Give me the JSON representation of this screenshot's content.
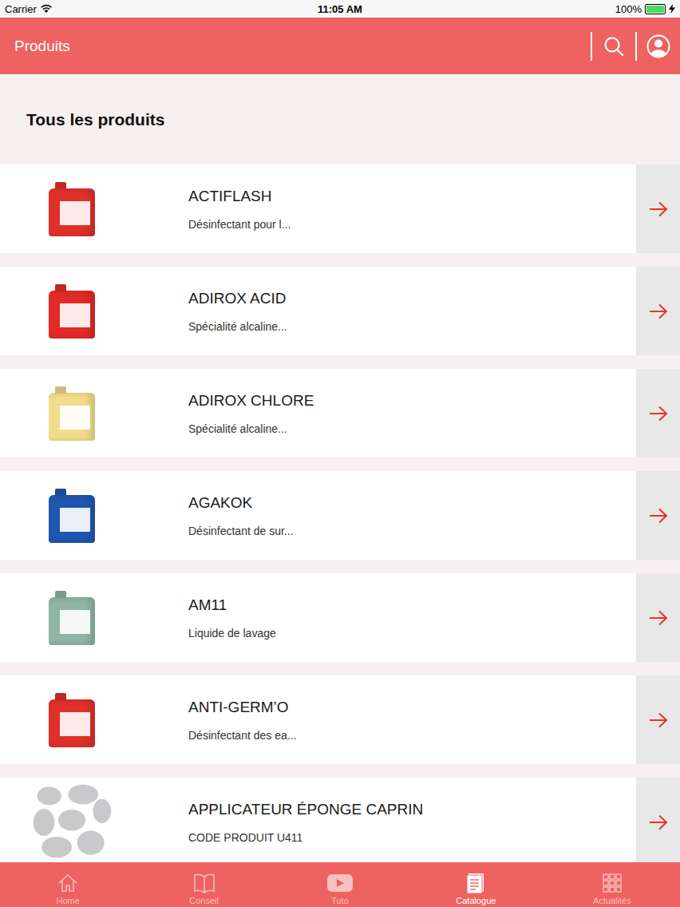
{
  "status_bar": {
    "carrier": "Carrier",
    "time": "11:05 AM",
    "battery": "100%",
    "battery_level": 1,
    "charging": true
  },
  "header": {
    "title": "Produits"
  },
  "section": {
    "title": "Tous les produits"
  },
  "products": [
    {
      "name": "ACTIFLASH",
      "description": "Désinfectant pour l...",
      "kind": "jug",
      "color": "#e0302a"
    },
    {
      "name": "ADIROX ACID",
      "description": "Spécialité alcaline...",
      "kind": "jug",
      "color": "#e22a26"
    },
    {
      "name": "ADIROX CHLORE",
      "description": "Spécialité alcaline...",
      "kind": "jug",
      "color": "#f2dc8c"
    },
    {
      "name": "AGAKOK",
      "description": "Désinfectant de sur...",
      "kind": "jug",
      "color": "#1f56b0"
    },
    {
      "name": "AM11",
      "description": "Liquide de lavage",
      "kind": "jug",
      "color": "#8fb5a4"
    },
    {
      "name": "ANTI-GERM’O",
      "description": "Désinfectant des ea...",
      "kind": "jug",
      "color": "#e0302a"
    },
    {
      "name": "APPLICATEUR ÉPONGE CAPRIN",
      "description": "CODE PRODUIT U411",
      "kind": "sponge",
      "color": "#c9c9cc"
    }
  ],
  "tabs": [
    {
      "label": "Home",
      "selected": false
    },
    {
      "label": "Conseil",
      "selected": false
    },
    {
      "label": "Tuto",
      "selected": false
    },
    {
      "label": "Catalogue",
      "selected": true
    },
    {
      "label": "Actualités",
      "selected": false
    }
  ]
}
